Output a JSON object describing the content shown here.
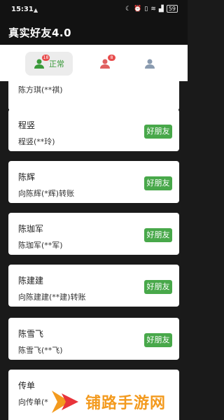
{
  "status_bar": {
    "time": "15:31",
    "icons": [
      "notification-icon",
      "moon-icon",
      "alarm-icon",
      "vibrate-icon",
      "wifi-icon",
      "signal-icon"
    ],
    "battery": "59"
  },
  "app": {
    "title": "真实好友4.0"
  },
  "tabs": [
    {
      "name": "normal",
      "label": "正常",
      "badge": "18",
      "color": "#3a9a3a",
      "active": true
    },
    {
      "name": "abnormal",
      "label": "",
      "badge": "8",
      "color": "#e06060",
      "active": false
    },
    {
      "name": "unknown",
      "label": "",
      "badge": "",
      "color": "#8a9bb0",
      "active": false
    }
  ],
  "contacts": [
    {
      "name": "",
      "sub": "陈方琪(**祺)",
      "button": ""
    },
    {
      "name": "程竖",
      "sub": "程竖(**玲)",
      "button": "好朋友"
    },
    {
      "name": "陈辉",
      "sub": "向陈辉(*辉)转账",
      "button": "好朋友"
    },
    {
      "name": "陈珈军",
      "sub": "陈珈军(**军)",
      "button": "好朋友"
    },
    {
      "name": "陈建建",
      "sub": "向陈建建(**建)转账",
      "button": "好朋友"
    },
    {
      "name": "陈雪飞",
      "sub": "陈雪飞(**飞)",
      "button": "好朋友"
    },
    {
      "name": "传单",
      "sub": "向传单(*",
      "button": ""
    }
  ],
  "watermark": {
    "text": "铺路手游网",
    "color": "#f39a1e"
  }
}
